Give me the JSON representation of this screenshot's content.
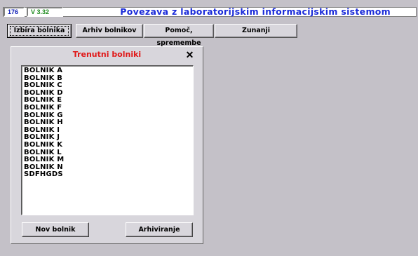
{
  "status": {
    "number": "176",
    "version": "V 3.32"
  },
  "app_title": "Povezava z laboratorijskim informacijskim sistemom",
  "nav": [
    {
      "label": "Izbira bolnika"
    },
    {
      "label": "Arhiv bolnikov"
    },
    {
      "label": "Pomoč, spremembe"
    },
    {
      "label": "Zunanji"
    }
  ],
  "panel": {
    "title": "Trenutni bolniki",
    "close_glyph": "✕",
    "patients": [
      "BOLNIK A",
      "BOLNIK B",
      "BOLNIK C",
      "BOLNIK D",
      "BOLNIK E",
      "BOLNIK F",
      "BOLNIK G",
      "BOLNIK H",
      "BOLNIK I",
      "BOLNIK J",
      "BOLNIK K",
      "BOLNIK L",
      "BOLNIK M",
      "BOLNIK N",
      "SDFHGDS"
    ],
    "new_button": "Nov bolnik",
    "archive_button": "Arhiviranje"
  },
  "colors": {
    "title_blue": "#1a2bd9",
    "panel_title_red": "#e01818",
    "version_green": "#1e8a1e"
  }
}
